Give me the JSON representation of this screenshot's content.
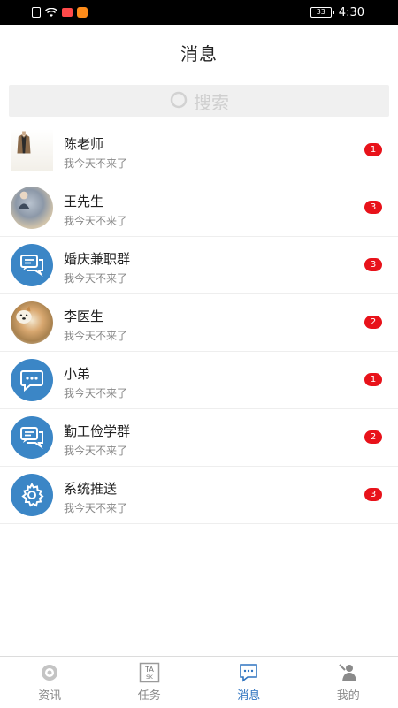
{
  "status_bar": {
    "battery": "33",
    "time": "4:30",
    "icons": [
      "sim-icon",
      "wifi-icon",
      "message-icon",
      "video-app-icon"
    ]
  },
  "header": {
    "title": "消息"
  },
  "search": {
    "placeholder": "搜索",
    "icon": "search-icon"
  },
  "conversations": [
    {
      "name": "陈老师",
      "preview": "我今天不来了",
      "unread": "1",
      "avatar": "photo"
    },
    {
      "name": "王先生",
      "preview": "我今天不来了",
      "unread": "3",
      "avatar": "photo"
    },
    {
      "name": "婚庆兼职群",
      "preview": "我今天不来了",
      "unread": "3",
      "avatar": "group-chat-icon"
    },
    {
      "name": "李医生",
      "preview": "我今天不来了",
      "unread": "2",
      "avatar": "photo"
    },
    {
      "name": "小弟",
      "preview": "我今天不来了",
      "unread": "1",
      "avatar": "chat-bubble-icon"
    },
    {
      "name": "勤工俭学群",
      "preview": "我今天不来了",
      "unread": "2",
      "avatar": "group-chat-icon"
    },
    {
      "name": "系统推送",
      "preview": "我今天不来了",
      "unread": "3",
      "avatar": "gear-icon"
    }
  ],
  "tabbar": {
    "active": "消息",
    "items": [
      {
        "label": "资讯",
        "icon": "news-icon"
      },
      {
        "label": "任务",
        "icon": "task-icon"
      },
      {
        "label": "消息",
        "icon": "message-icon"
      },
      {
        "label": "我的",
        "icon": "profile-icon"
      }
    ]
  },
  "colors": {
    "accent": "#2f74c0",
    "badge": "#e8121a",
    "avatar_blue": "#3b86c6"
  }
}
